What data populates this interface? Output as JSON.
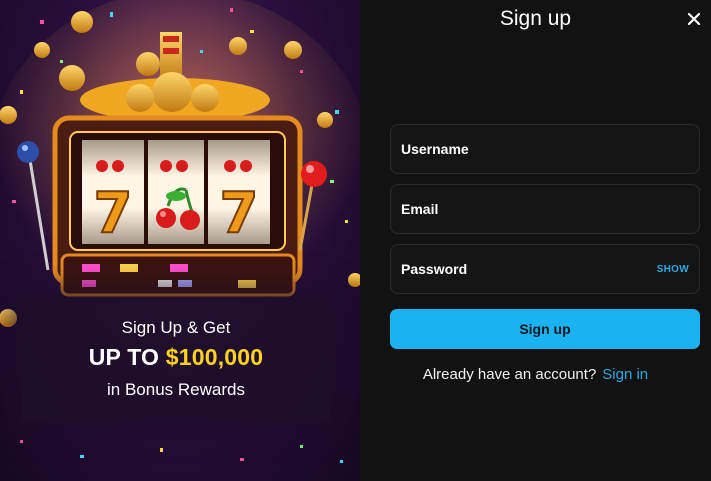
{
  "promo": {
    "line1": "Sign Up & Get",
    "line2_prefix": "UP TO ",
    "line2_amount": "$100,000",
    "line3": "in Bonus Rewards",
    "highlight_color": "#ffd21f"
  },
  "form": {
    "title": "Sign up",
    "close_icon": "close-icon",
    "username_placeholder": "Username",
    "email_placeholder": "Email",
    "password_placeholder": "Password",
    "password_toggle": "SHOW",
    "submit_label": "Sign up",
    "signin_question": "Already have an account?",
    "signin_link": "Sign in",
    "accent_color": "#1ab2f0"
  }
}
